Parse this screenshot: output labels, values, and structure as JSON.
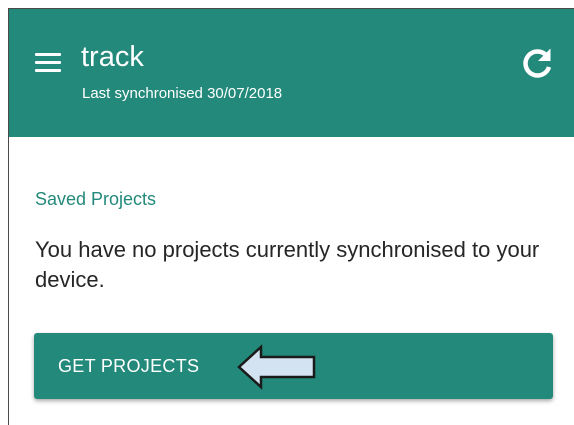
{
  "app_bar": {
    "title": "track",
    "subtitle": "Last synchronised 30/07/2018",
    "menu_icon": "hamburger-menu-icon",
    "refresh_icon": "refresh-icon",
    "color": "#23897a"
  },
  "content": {
    "section_label": "Saved Projects",
    "empty_message": "You have no projects currently synchronised to your device.",
    "button_label": "GET PROJECTS",
    "annotation_icon": "left-arrow-icon",
    "accent_color": "#23897a",
    "annotation_color": "#d4e3f2"
  }
}
